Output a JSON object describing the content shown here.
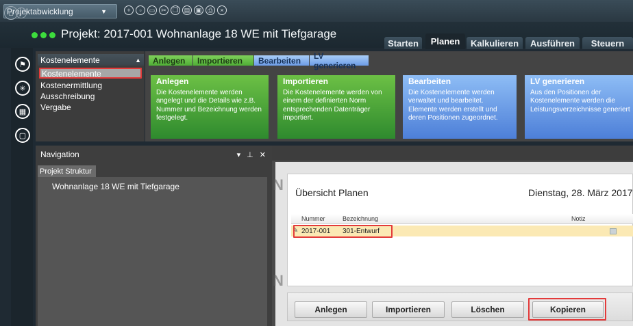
{
  "toolbar": {
    "project_dropdown": "Projektabwicklung",
    "icons": [
      "new-icon",
      "open-icon",
      "folder-icon",
      "cut-icon",
      "copy-icon",
      "paste-icon",
      "save-icon",
      "print-icon",
      "close-icon"
    ]
  },
  "titlebar": {
    "title": "Projekt: 2017-001 Wohnanlage 18 WE mit Tiefgarage",
    "tabs": [
      "Starten",
      "Planen",
      "Kalkulieren",
      "Ausführen",
      "Steuern"
    ],
    "active_tab": "Planen"
  },
  "categories": {
    "header": "Kostenelemente",
    "items": [
      "Kostenelemente",
      "Kostenermittlung",
      "Ausschreibung",
      "Vergabe"
    ],
    "selected": "Kostenelemente"
  },
  "ribbon": {
    "subtabs": [
      "Anlegen",
      "Importieren",
      "Bearbeiten",
      "LV generieren"
    ],
    "cards": [
      {
        "title": "Anlegen",
        "text": "Die Kostenelemente werden angelegt und die Details wie z.B. Nummer und Bezeichnung werden festgelegt."
      },
      {
        "title": "Importieren",
        "text": "Die Kostenelemente werden von einem der definierten Norm entsprechenden Datenträger importiert."
      },
      {
        "title": "Bearbeiten",
        "text": "Die Kostenelemente werden verwaltet und bearbeitet. Elemente werden erstellt und deren Positionen zugeordnet."
      },
      {
        "title": "LV generieren",
        "text": "Aus den Positionen der Kostenelemente werden die Leistungsverzeichnisse generiert"
      }
    ]
  },
  "navigation": {
    "title": "Navigation",
    "controls": "▾ ⊥ ✕",
    "tab": "Projekt Struktur",
    "tree_item": "Wohnanlage 18 WE mit Tiefgarage"
  },
  "overview": {
    "title": "Übersicht Planen",
    "date": "Dienstag, 28. März 2017",
    "columns": [
      "Nummer",
      "Bezeichnung",
      "Notiz"
    ],
    "rows": [
      {
        "nummer": "2017-001",
        "bezeichnung": "301-Entwurf",
        "notiz": ""
      }
    ]
  },
  "buttons": {
    "anlegen": "Anlegen",
    "importieren": "Importieren",
    "loeschen": "Löschen",
    "kopieren": "Kopieren"
  },
  "colors": {
    "highlight_red": "#e33a3a",
    "status_green": "#3ddc3d",
    "card_green": "#4aa83a",
    "card_blue": "#6a9ce8",
    "row_selected": "#fbe9b4"
  }
}
